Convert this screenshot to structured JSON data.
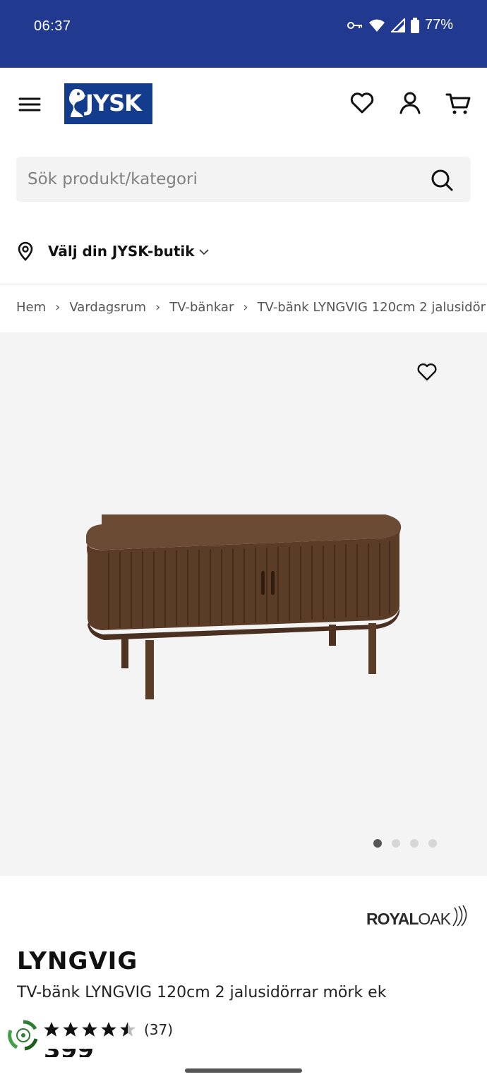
{
  "status_bar": {
    "time": "06:37",
    "battery": "77%"
  },
  "header": {
    "logo_text": "JYSK"
  },
  "search": {
    "placeholder": "Sök produkt/kategori"
  },
  "store": {
    "label": "Välj din JYSK-butik"
  },
  "breadcrumb": [
    "Hem",
    "Vardagsrum",
    "TV-bänkar",
    "TV-bänk LYNGVIG 120cm 2 jalusidör"
  ],
  "gallery": {
    "image_count": 4,
    "active_index": 0
  },
  "brand": {
    "part1": "ROYAL",
    "part2": "OAK"
  },
  "product": {
    "name": "LYNGVIG",
    "description": "TV-bänk LYNGVIG 120cm 2 jalusidörrar mörk ek",
    "rating": 4.5,
    "review_count": "(37)",
    "price_partial": "399"
  },
  "colors": {
    "brand_blue": "#143c8c",
    "status_blue": "#213a8f",
    "wood": "#5b3f2a"
  }
}
